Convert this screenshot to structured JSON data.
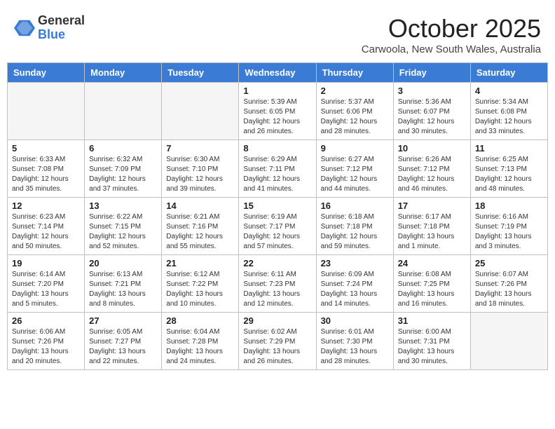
{
  "header": {
    "logo_general": "General",
    "logo_blue": "Blue",
    "month_title": "October 2025",
    "location": "Carwoola, New South Wales, Australia"
  },
  "days_of_week": [
    "Sunday",
    "Monday",
    "Tuesday",
    "Wednesday",
    "Thursday",
    "Friday",
    "Saturday"
  ],
  "weeks": [
    [
      {
        "day": "",
        "info": ""
      },
      {
        "day": "",
        "info": ""
      },
      {
        "day": "",
        "info": ""
      },
      {
        "day": "1",
        "info": "Sunrise: 5:39 AM\nSunset: 6:05 PM\nDaylight: 12 hours\nand 26 minutes."
      },
      {
        "day": "2",
        "info": "Sunrise: 5:37 AM\nSunset: 6:06 PM\nDaylight: 12 hours\nand 28 minutes."
      },
      {
        "day": "3",
        "info": "Sunrise: 5:36 AM\nSunset: 6:07 PM\nDaylight: 12 hours\nand 30 minutes."
      },
      {
        "day": "4",
        "info": "Sunrise: 5:34 AM\nSunset: 6:08 PM\nDaylight: 12 hours\nand 33 minutes."
      }
    ],
    [
      {
        "day": "5",
        "info": "Sunrise: 6:33 AM\nSunset: 7:08 PM\nDaylight: 12 hours\nand 35 minutes."
      },
      {
        "day": "6",
        "info": "Sunrise: 6:32 AM\nSunset: 7:09 PM\nDaylight: 12 hours\nand 37 minutes."
      },
      {
        "day": "7",
        "info": "Sunrise: 6:30 AM\nSunset: 7:10 PM\nDaylight: 12 hours\nand 39 minutes."
      },
      {
        "day": "8",
        "info": "Sunrise: 6:29 AM\nSunset: 7:11 PM\nDaylight: 12 hours\nand 41 minutes."
      },
      {
        "day": "9",
        "info": "Sunrise: 6:27 AM\nSunset: 7:12 PM\nDaylight: 12 hours\nand 44 minutes."
      },
      {
        "day": "10",
        "info": "Sunrise: 6:26 AM\nSunset: 7:12 PM\nDaylight: 12 hours\nand 46 minutes."
      },
      {
        "day": "11",
        "info": "Sunrise: 6:25 AM\nSunset: 7:13 PM\nDaylight: 12 hours\nand 48 minutes."
      }
    ],
    [
      {
        "day": "12",
        "info": "Sunrise: 6:23 AM\nSunset: 7:14 PM\nDaylight: 12 hours\nand 50 minutes."
      },
      {
        "day": "13",
        "info": "Sunrise: 6:22 AM\nSunset: 7:15 PM\nDaylight: 12 hours\nand 52 minutes."
      },
      {
        "day": "14",
        "info": "Sunrise: 6:21 AM\nSunset: 7:16 PM\nDaylight: 12 hours\nand 55 minutes."
      },
      {
        "day": "15",
        "info": "Sunrise: 6:19 AM\nSunset: 7:17 PM\nDaylight: 12 hours\nand 57 minutes."
      },
      {
        "day": "16",
        "info": "Sunrise: 6:18 AM\nSunset: 7:18 PM\nDaylight: 12 hours\nand 59 minutes."
      },
      {
        "day": "17",
        "info": "Sunrise: 6:17 AM\nSunset: 7:18 PM\nDaylight: 13 hours\nand 1 minute."
      },
      {
        "day": "18",
        "info": "Sunrise: 6:16 AM\nSunset: 7:19 PM\nDaylight: 13 hours\nand 3 minutes."
      }
    ],
    [
      {
        "day": "19",
        "info": "Sunrise: 6:14 AM\nSunset: 7:20 PM\nDaylight: 13 hours\nand 5 minutes."
      },
      {
        "day": "20",
        "info": "Sunrise: 6:13 AM\nSunset: 7:21 PM\nDaylight: 13 hours\nand 8 minutes."
      },
      {
        "day": "21",
        "info": "Sunrise: 6:12 AM\nSunset: 7:22 PM\nDaylight: 13 hours\nand 10 minutes."
      },
      {
        "day": "22",
        "info": "Sunrise: 6:11 AM\nSunset: 7:23 PM\nDaylight: 13 hours\nand 12 minutes."
      },
      {
        "day": "23",
        "info": "Sunrise: 6:09 AM\nSunset: 7:24 PM\nDaylight: 13 hours\nand 14 minutes."
      },
      {
        "day": "24",
        "info": "Sunrise: 6:08 AM\nSunset: 7:25 PM\nDaylight: 13 hours\nand 16 minutes."
      },
      {
        "day": "25",
        "info": "Sunrise: 6:07 AM\nSunset: 7:26 PM\nDaylight: 13 hours\nand 18 minutes."
      }
    ],
    [
      {
        "day": "26",
        "info": "Sunrise: 6:06 AM\nSunset: 7:26 PM\nDaylight: 13 hours\nand 20 minutes."
      },
      {
        "day": "27",
        "info": "Sunrise: 6:05 AM\nSunset: 7:27 PM\nDaylight: 13 hours\nand 22 minutes."
      },
      {
        "day": "28",
        "info": "Sunrise: 6:04 AM\nSunset: 7:28 PM\nDaylight: 13 hours\nand 24 minutes."
      },
      {
        "day": "29",
        "info": "Sunrise: 6:02 AM\nSunset: 7:29 PM\nDaylight: 13 hours\nand 26 minutes."
      },
      {
        "day": "30",
        "info": "Sunrise: 6:01 AM\nSunset: 7:30 PM\nDaylight: 13 hours\nand 28 minutes."
      },
      {
        "day": "31",
        "info": "Sunrise: 6:00 AM\nSunset: 7:31 PM\nDaylight: 13 hours\nand 30 minutes."
      },
      {
        "day": "",
        "info": ""
      }
    ]
  ]
}
